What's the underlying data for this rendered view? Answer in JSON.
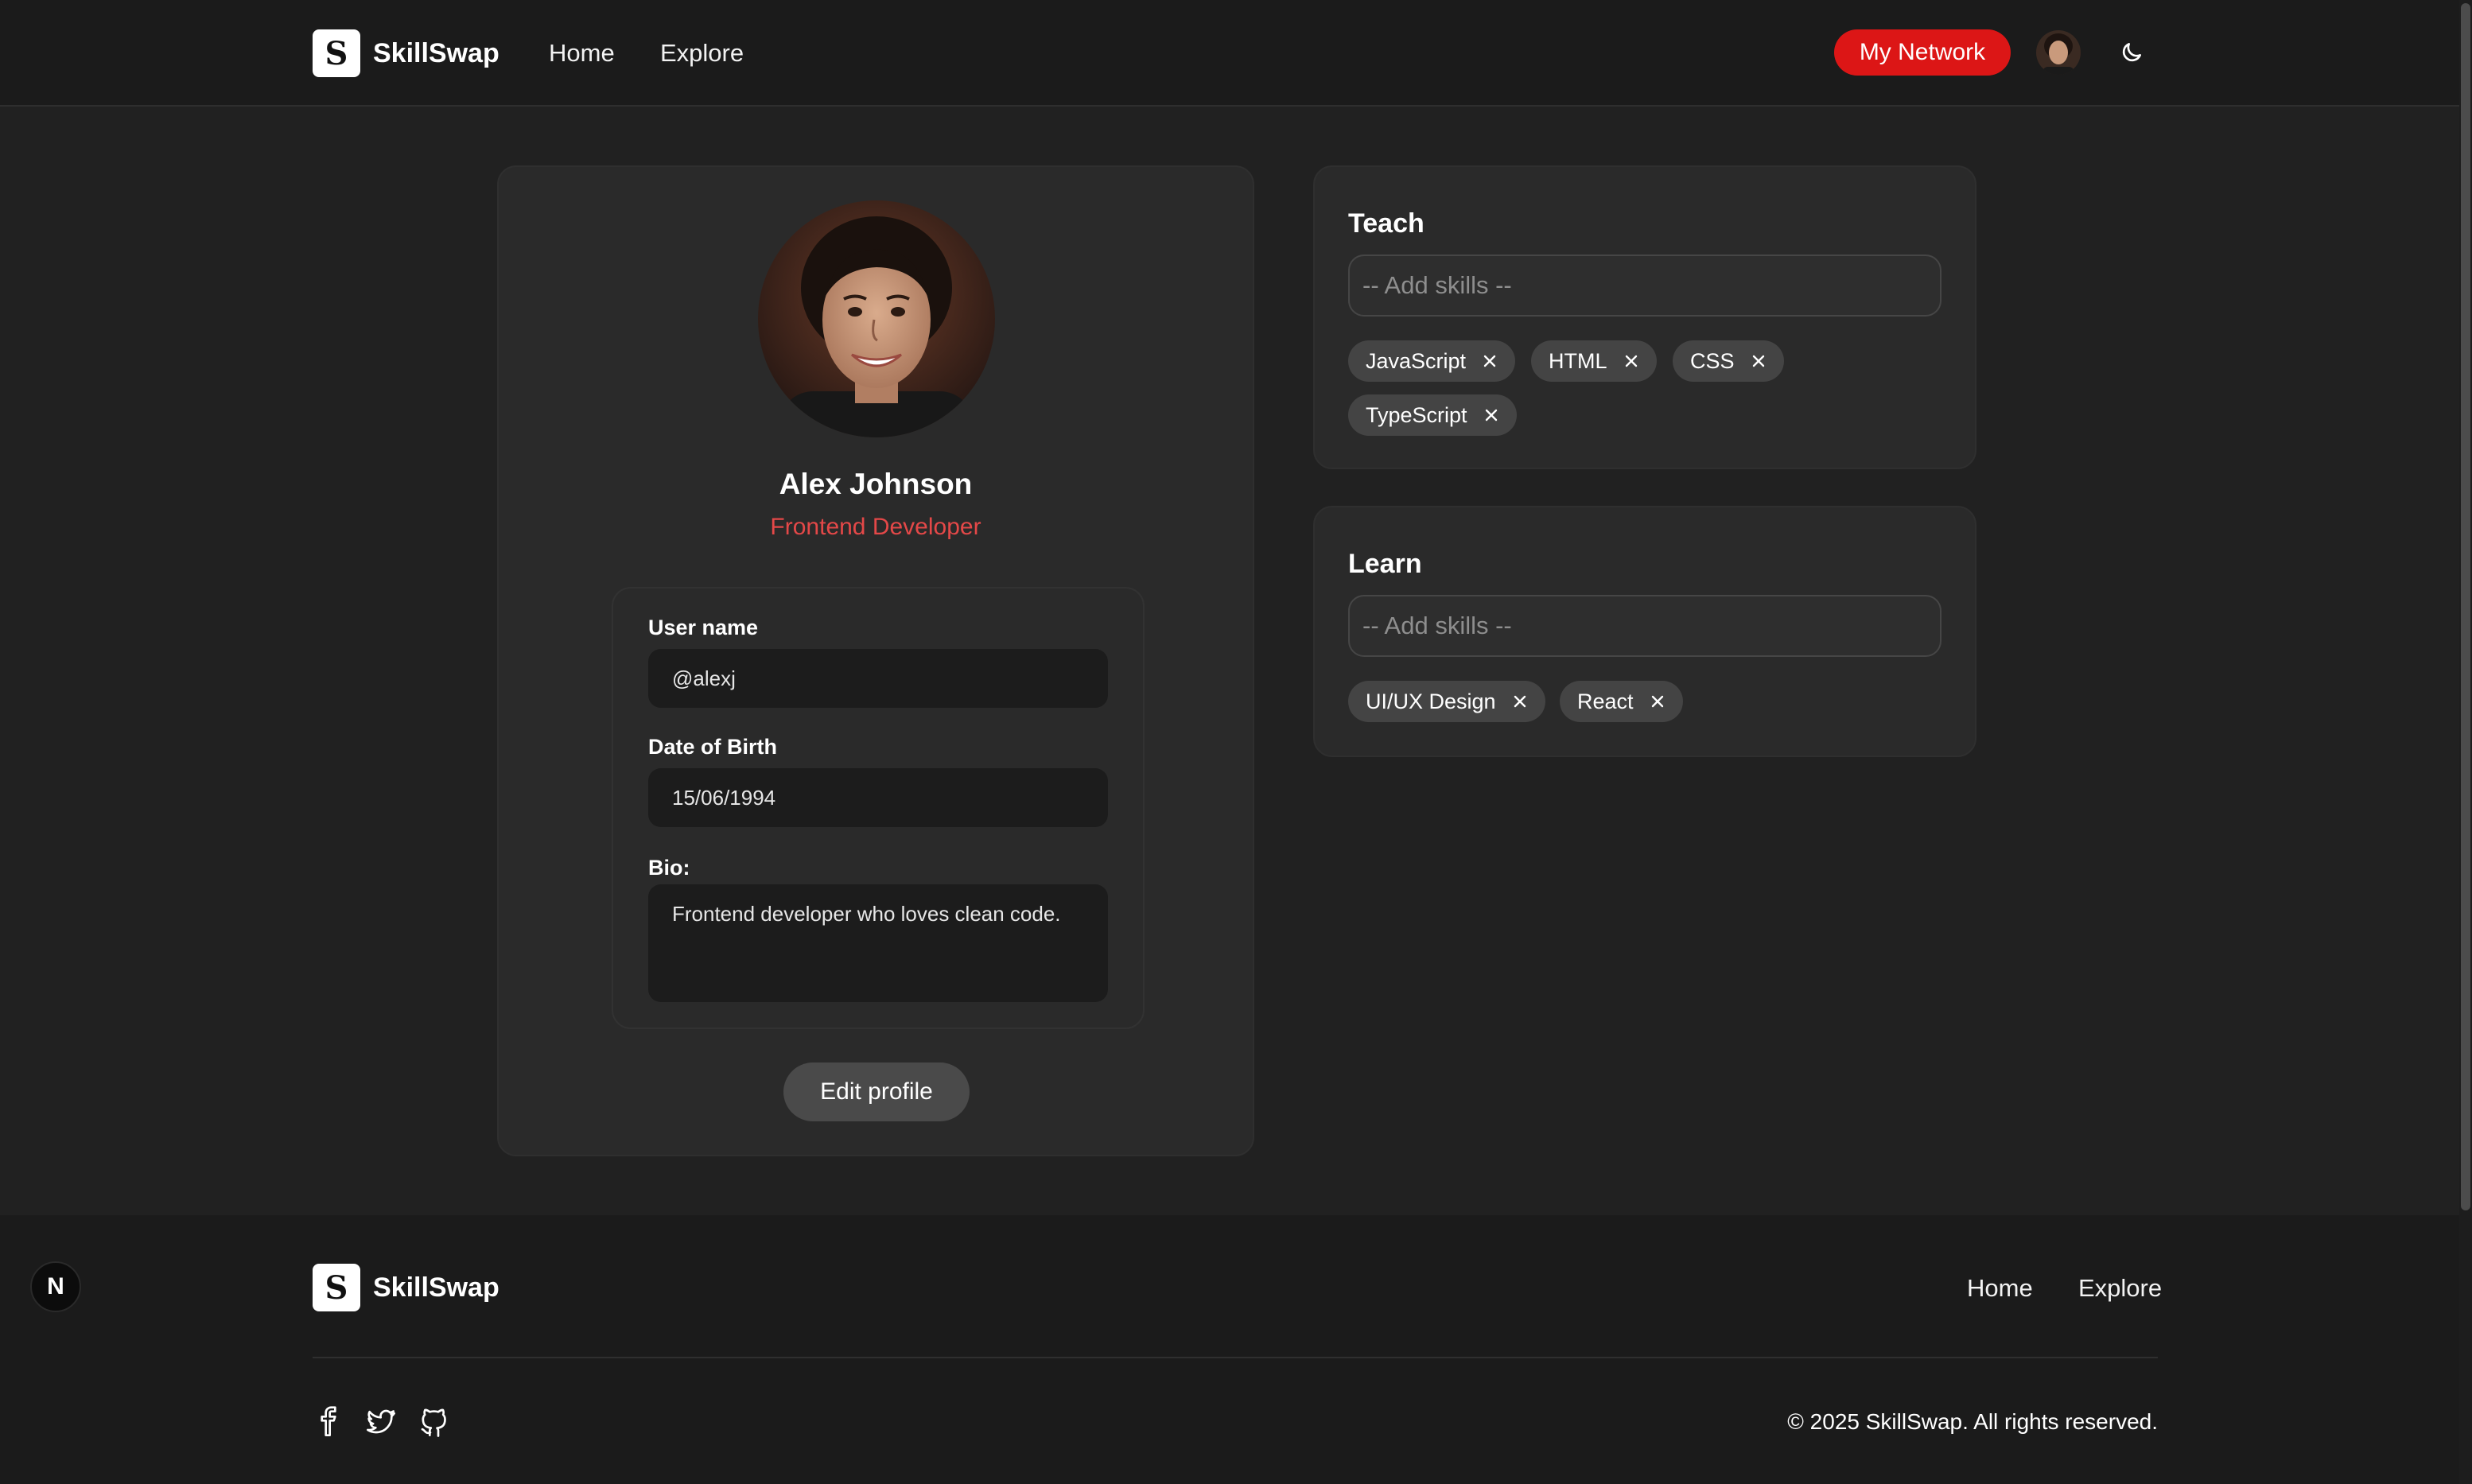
{
  "header": {
    "brand": {
      "mark": "S",
      "name": "SkillSwap"
    },
    "nav": [
      {
        "label": "Home"
      },
      {
        "label": "Explore"
      }
    ],
    "network_button": "My Network",
    "avatar_icon": "user-avatar",
    "theme_icon": "moon-icon"
  },
  "profile": {
    "name": "Alex Johnson",
    "role": "Frontend Developer",
    "fields": {
      "username_label": "User name",
      "username_value": "@alexj",
      "dob_label": "Date of Birth",
      "dob_value": "15/06/1994",
      "bio_label": "Bio:",
      "bio_value": "Frontend developer who loves clean code."
    },
    "edit_button": "Edit profile"
  },
  "teach": {
    "title": "Teach",
    "placeholder": "-- Add skills --",
    "skills": [
      "JavaScript",
      "HTML",
      "CSS",
      "TypeScript"
    ]
  },
  "learn": {
    "title": "Learn",
    "placeholder": "-- Add skills --",
    "skills": [
      "UI/UX Design",
      "React"
    ]
  },
  "footer": {
    "brand": {
      "mark": "S",
      "name": "SkillSwap"
    },
    "nav": [
      {
        "label": "Home"
      },
      {
        "label": "Explore"
      }
    ],
    "social_icons": [
      "facebook-icon",
      "twitter-icon",
      "github-icon"
    ],
    "copyright": "© 2025 SkillSwap. All rights reserved."
  },
  "dev_badge": "N",
  "colors": {
    "accent_red": "#dc1616",
    "role_red": "#e44848",
    "background": "#212121",
    "card": "#2a2a2a"
  }
}
